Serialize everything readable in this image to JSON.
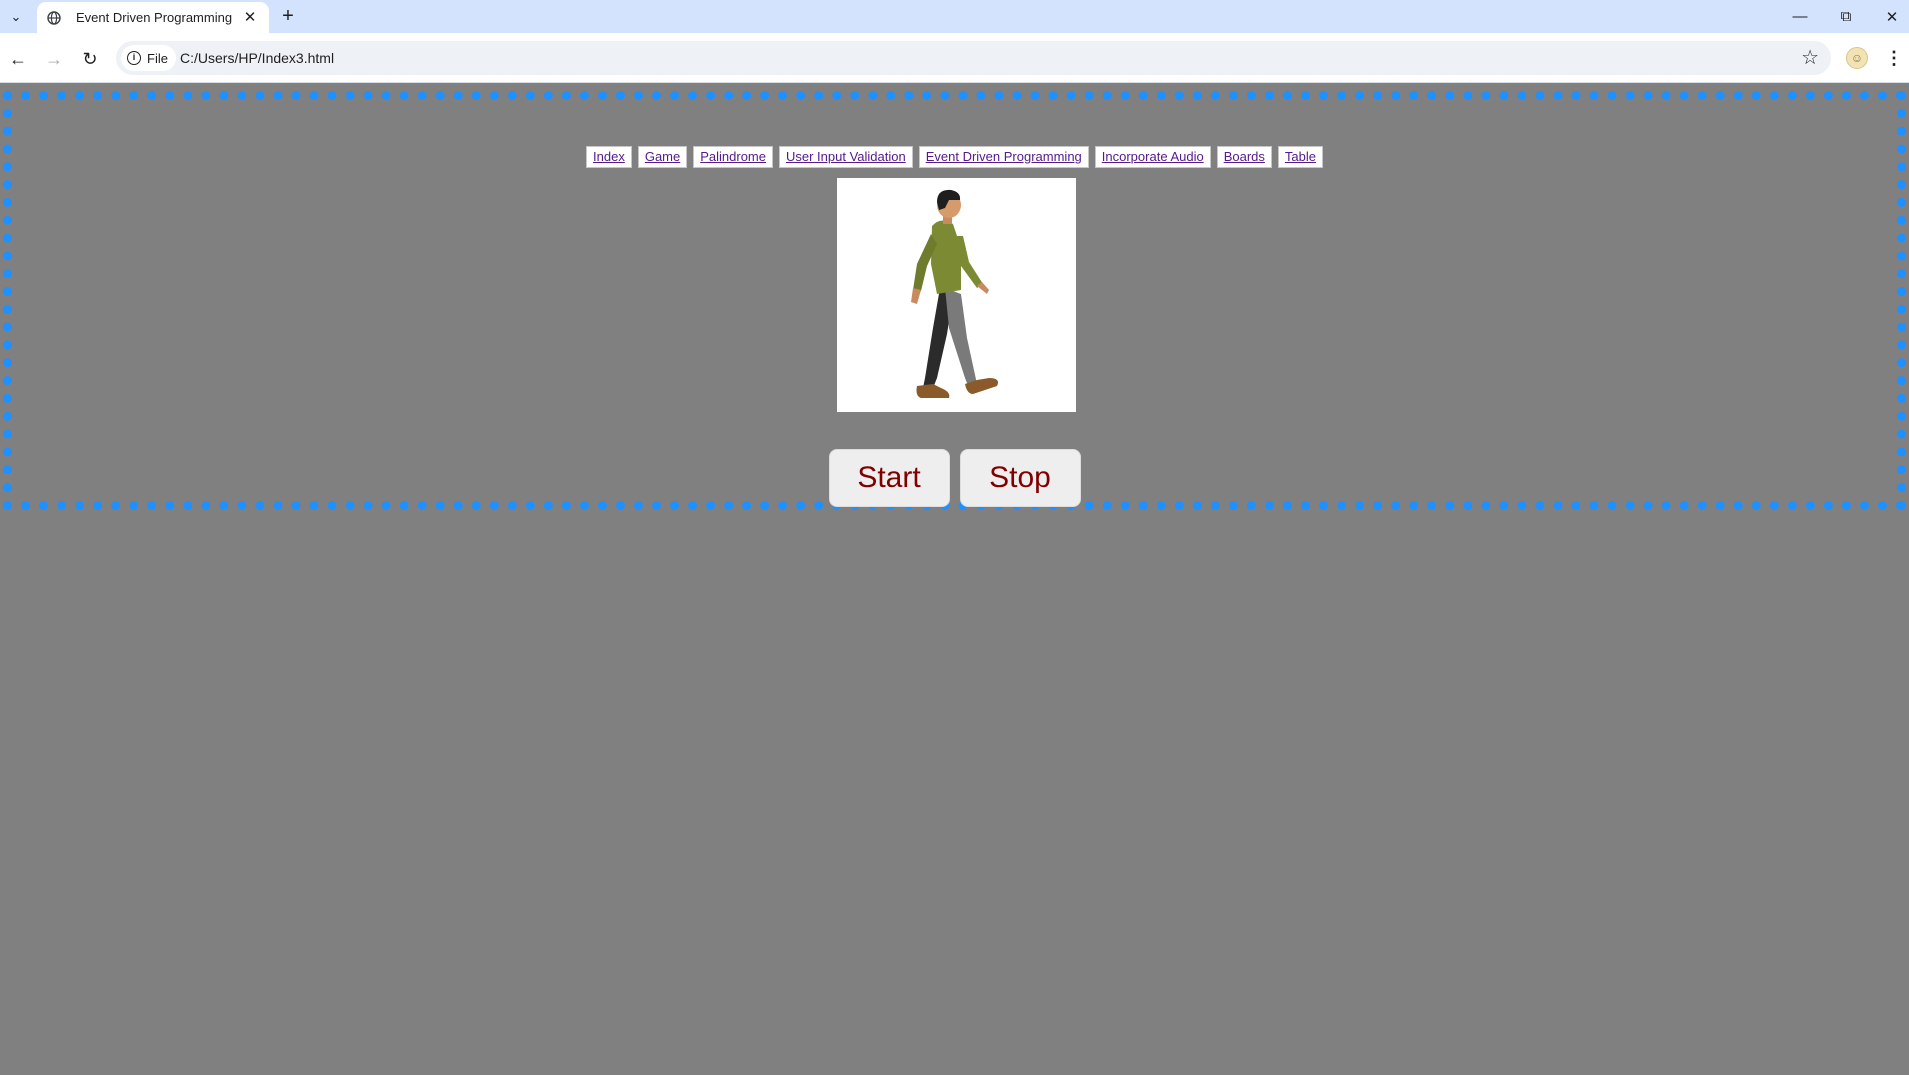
{
  "browser": {
    "tab": {
      "title": "Event Driven Programming"
    },
    "address": {
      "scheme_label": "File",
      "url": "C:/Users/HP/Index3.html"
    }
  },
  "page": {
    "nav_links": [
      {
        "label": "Index"
      },
      {
        "label": "Game"
      },
      {
        "label": "Palindrome"
      },
      {
        "label": "User Input Validation"
      },
      {
        "label": "Event Driven Programming"
      },
      {
        "label": "Incorporate Audio"
      },
      {
        "label": "Boards"
      },
      {
        "label": "Table"
      }
    ],
    "image": {
      "alt": "walking man illustration"
    },
    "buttons": {
      "start": "Start",
      "stop": "Stop"
    },
    "colors": {
      "page_background": "#808080",
      "frame_border": "#1e90ff",
      "button_text": "#800000",
      "link_text": "#551a8b"
    }
  }
}
